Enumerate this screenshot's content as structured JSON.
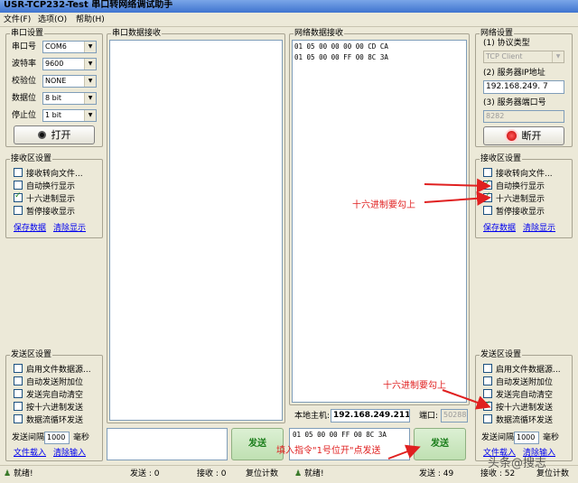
{
  "window": {
    "title": "USR-TCP232-Test 串口转网络调试助手"
  },
  "menu": {
    "file": "文件(F)",
    "options": "选项(O)",
    "help": "帮助(H)"
  },
  "serial_settings": {
    "title": "串口设置",
    "port_label": "串口号",
    "port_value": "COM6",
    "baud_label": "波特率",
    "baud_value": "9600",
    "parity_label": "校验位",
    "parity_value": "NONE",
    "data_label": "数据位",
    "data_value": "8 bit",
    "stop_label": "停止位",
    "stop_value": "1 bit",
    "open_button": "打开"
  },
  "left_receive": {
    "title": "接收区设置",
    "options": [
      {
        "label": "接收转向文件...",
        "checked": false
      },
      {
        "label": "自动换行显示",
        "checked": false
      },
      {
        "label": "十六进制显示",
        "checked": true
      },
      {
        "label": "暂停接收显示",
        "checked": false
      }
    ],
    "save_link": "保存数据",
    "clear_link": "清除显示"
  },
  "left_send": {
    "title": "发送区设置",
    "options": [
      {
        "label": "启用文件数据源...",
        "checked": false
      },
      {
        "label": "自动发送附加位",
        "checked": false
      },
      {
        "label": "发送完自动清空",
        "checked": false
      },
      {
        "label": "按十六进制发送",
        "checked": false
      },
      {
        "label": "数据流循环发送",
        "checked": false
      }
    ],
    "interval_label": "发送间隔",
    "interval_value": "1000",
    "interval_unit": "毫秒",
    "load_link": "文件载入",
    "clear_link": "清除输入"
  },
  "serial_receive_panel": {
    "title": "串口数据接收"
  },
  "serial_send": {
    "send_button": "发送"
  },
  "network_receive_panel": {
    "title": "网络数据接收",
    "lines": [
      "01 05 00 00 00 00 CD CA",
      "01 05 00 00 FF 00 8C 3A"
    ]
  },
  "host": {
    "label": "本地主机:",
    "ip": "192.168.249.211",
    "port_label": "端口:",
    "port_value": "50288"
  },
  "network_send": {
    "input_value": "01 05 00 00 FF 00 8C 3A",
    "send_button": "发送"
  },
  "network_settings": {
    "title": "网络设置",
    "protocol_label": "(1) 协议类型",
    "protocol_value": "TCP Client",
    "server_ip_label": "(2) 服务器IP地址",
    "server_ip_value": "192.168.249. 7",
    "server_port_label": "(3) 服务器端口号",
    "server_port_value": "8282",
    "disconnect_button": "断开"
  },
  "right_receive": {
    "title": "接收区设置",
    "options": [
      {
        "label": "接收转向文件...",
        "checked": false
      },
      {
        "label": "自动换行显示",
        "checked": true
      },
      {
        "label": "十六进制显示",
        "checked": true
      },
      {
        "label": "暂停接收显示",
        "checked": false
      }
    ],
    "save_link": "保存数据",
    "clear_link": "清除显示"
  },
  "right_send": {
    "title": "发送区设置",
    "options": [
      {
        "label": "启用文件数据源...",
        "checked": false
      },
      {
        "label": "自动发送附加位",
        "checked": false
      },
      {
        "label": "发送完自动清空",
        "checked": false
      },
      {
        "label": "按十六进制发送",
        "checked": true
      },
      {
        "label": "数据流循环发送",
        "checked": false
      }
    ],
    "interval_label": "发送间隔",
    "interval_value": "1000",
    "interval_unit": "毫秒",
    "load_link": "文件载入",
    "clear_link": "清除输入"
  },
  "status_bar": {
    "left_ready": "就绪!",
    "left_sent": "发送 : 0",
    "left_recv": "接收 : 0",
    "left_reset": "复位计数",
    "right_ready": "就绪!",
    "right_sent": "发送 : 49",
    "right_recv": "接收 : 52",
    "right_reset": "复位计数"
  },
  "annotations": {
    "hex_display_note": "十六进制要勾上",
    "hex_send_note": "十六进制要勾上",
    "command_note": "填入指令\"1号位开\"点发送"
  },
  "watermark": {
    "text": "头条@搜志"
  },
  "colors": {
    "accent_red": "#e02020",
    "link_blue": "#0000ee",
    "send_green": "#1a7d1a"
  }
}
